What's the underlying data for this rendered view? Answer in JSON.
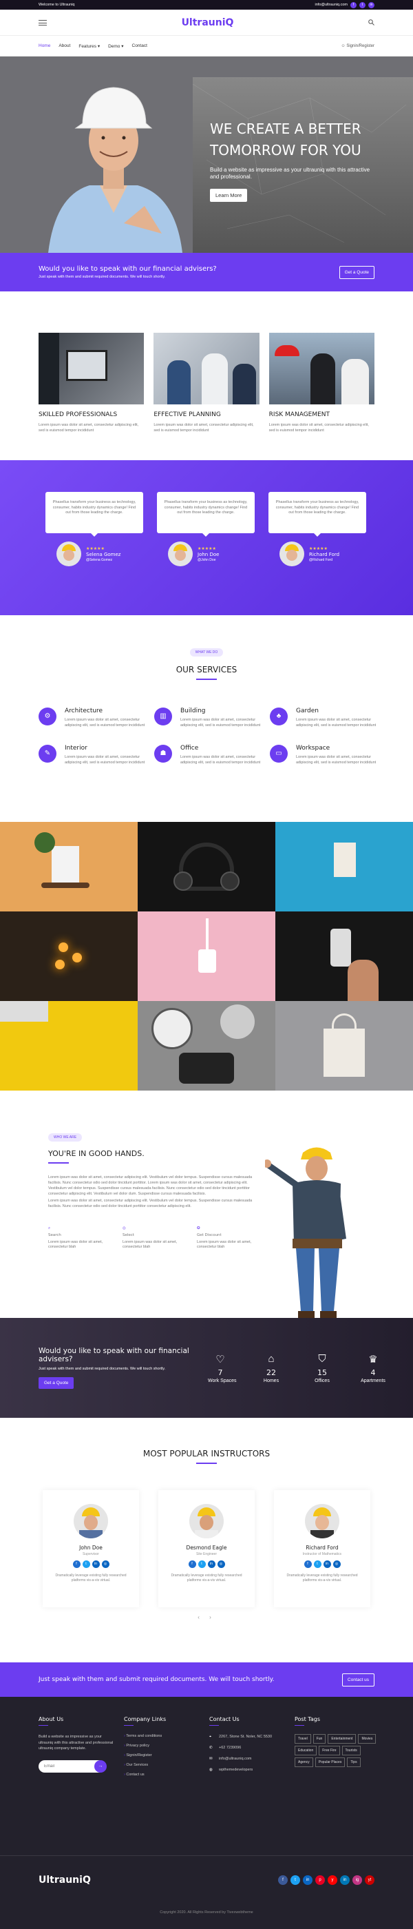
{
  "topbar": {
    "welcome": "Welcome to Ultrauniq",
    "email": "info@ultrauniq.com",
    "social": [
      "f",
      "t",
      "in"
    ]
  },
  "header": {
    "logo": "UltrauniQ"
  },
  "nav": {
    "items": [
      "Home",
      "About",
      "Features",
      "Demo",
      "Contact"
    ],
    "features_label": "Features",
    "demo_label": "Demo",
    "signin": "Signin/Register"
  },
  "hero": {
    "title_line1": "WE CREATE A BETTER",
    "title_line2": "TOMORROW FOR YOU",
    "text": "Build a website as impressive as your ultrauniq with this attractive and professional.",
    "button": "Learn More"
  },
  "cta": {
    "title": "Would you like to speak with our financial advisers?",
    "subtitle": "Just speak with them and submit required documents. We will touch shortly.",
    "button": "Get a Quote"
  },
  "features": [
    {
      "title": "SKILLED PROFESSIONALS",
      "text": "Lorem ipsum was dolor sit amet, consectetur adipiscing elit, sed is euismod tempor incididunt"
    },
    {
      "title": "EFFECTIVE PLANNING",
      "text": "Lorem ipsum was dolor sit amet, consectetur adipiscing elit, sed is euismod tempor incididunt"
    },
    {
      "title": "RISK MANAGEMENT",
      "text": "Lorem ipsum was dolor sit amet, consectetur adipiscing elit, sed is euismod tempor incididunt"
    }
  ],
  "testimonials": [
    {
      "text": "Phasellus transform your business as technology, consumer, habits industry dynamics change! Find out from those leading the charge.",
      "stars": "★★★★★",
      "name": "Selena Gomez",
      "handle": "@Selena Gomez"
    },
    {
      "text": "Phasellus transform your business as technology, consumer, habits industry dynamics change! Find out from those leading the charge.",
      "stars": "★★★★★",
      "name": "John Doe",
      "handle": "@John Doe"
    },
    {
      "text": "Phasellus transform your business as technology, consumer, habits industry dynamics change! Find out from those leading the charge.",
      "stars": "★★★★★",
      "name": "Richard Ford",
      "handle": "@Richard Ford"
    }
  ],
  "services": {
    "pill": "WHAT WE DO",
    "title": "OUR SERVICES",
    "items": [
      {
        "title": "Architecture",
        "text": "Lorem ipsum was dolor sit amet, consectetur adipiscing elit, sed is euismod tempor incididunt",
        "icon": "gear-icon"
      },
      {
        "title": "Building",
        "text": "Lorem ipsum was dolor sit amet, consectetur adipiscing elit, sed is euismod tempor incididunt",
        "icon": "building-icon"
      },
      {
        "title": "Garden",
        "text": "Lorem ipsum was dolor sit amet, consectetur adipiscing elit, sed is euismod tempor incididunt",
        "icon": "tree-icon"
      },
      {
        "title": "Interior",
        "text": "Lorem ipsum was dolor sit amet, consectetur adipiscing elit, sed is euismod tempor incididunt",
        "icon": "palette-icon"
      },
      {
        "title": "Office",
        "text": "Lorem ipsum was dolor sit amet, consectetur adipiscing elit, sed is euismod tempor incididunt",
        "icon": "office-icon"
      },
      {
        "title": "Workspace",
        "text": "Lorem ipsum was dolor sit amet, consectetur adipiscing elit, sed is euismod tempor incididunt",
        "icon": "desk-icon"
      }
    ]
  },
  "about": {
    "pill": "WHO WE ARE",
    "title": "YOU'RE IN GOOD HANDS.",
    "p1": "Lorem ipsum was dolor sit amet, consectetur adipiscing elit. Vestibulum vel dolor tempus. Suspendisse cursus malesuada facilisis. Nunc consectetur odio sed dolor tincidunt porttitor. Lorem ipsum was dolor sit amet, consectetur adipiscing elit. Vestibulum vel dolor tempus. Suspendisse cursus malesuada facilisis. Nunc consectetur odio sed dolor tincidunt porttitor consectetur adipiscing elit. Vestibulum vel dolor dum. Suspendisse cursus malesuada facilisis.",
    "p2": "Lorem ipsum was dolor sit amet, consectetur adipiscing elit. Vestibulum vel dolor tempus. Suspendisse cursus malesuada facilisis. Nunc consectetur odio sed dolor tincidunt porttitor consectetur adipiscing elit.",
    "mini": [
      {
        "title": "Search",
        "text": "Lorem ipsum was dolor sit amet, consectetur blah"
      },
      {
        "title": "Select",
        "text": "Lorem ipsum was dolor sit amet, consectetur blah"
      },
      {
        "title": "Get Discount",
        "text": "Lorem ipsum was dolor sit amet, consectetur blah"
      }
    ]
  },
  "stats": {
    "title": "Would you like to speak with our financial advisers?",
    "subtitle": "Just speak with them and submit required documents. We will touch shortly.",
    "button": "Get a Quote",
    "items": [
      {
        "icon": "♡",
        "value": "7",
        "label": "Work Spaces"
      },
      {
        "icon": "⌂",
        "value": "22",
        "label": "Homes"
      },
      {
        "icon": "⛉",
        "value": "15",
        "label": "Offices"
      },
      {
        "icon": "♛",
        "value": "4",
        "label": "Apartments"
      }
    ]
  },
  "instructors": {
    "title": "MOST POPULAR INSTRUCTORS",
    "items": [
      {
        "name": "John Doe",
        "role": "Supervisor",
        "text": "Dramatically leverage existing fully researched platforms vis-a-vis virtual."
      },
      {
        "name": "Desmond Eagle",
        "role": "Site Engineer",
        "text": "Dramatically leverage existing fully researched platforms vis-a-vis virtual."
      },
      {
        "name": "Richard Ford",
        "role": "Instructor of Mathematics",
        "text": "Dramatically leverage existing fully researched platforms vis-a-vis virtual."
      }
    ],
    "arrows": "‹ ›"
  },
  "cta2": {
    "title": "Just speak with them and submit required documents. We will touch shortly.",
    "button": "Contact us"
  },
  "footer": {
    "about_title": "About Us",
    "about_text": "Build a website as impressive as your ultrauniq with this attractive and professional ultrauniq company template.",
    "email_placeholder": "Email",
    "links_title": "Company Links",
    "links": [
      "Terms and conditions",
      "Privacy policy",
      "Signin/Register",
      "Our Services",
      "Contact us"
    ],
    "contact_title": "Contact Us",
    "address": "2267, Stone St. Noler, NC 5530",
    "phone": "+62 7239096",
    "email": "info@ultrauniq.com",
    "web": "wpthemedevelopers",
    "tags_title": "Post Tags",
    "tags": [
      "Travel",
      "Fun",
      "Entertainment",
      "Movies",
      "Education",
      "Free Fire",
      "Tourists",
      "Agency",
      "Popular Places",
      "Tips"
    ]
  },
  "bottom": {
    "logo": "UltrauniQ",
    "social": [
      "f",
      "t",
      "in",
      "p",
      "y",
      "in",
      "ig",
      "yt"
    ],
    "copyright": "Copyright 2020. All Rights Reserved by Tivexwebtheme"
  }
}
